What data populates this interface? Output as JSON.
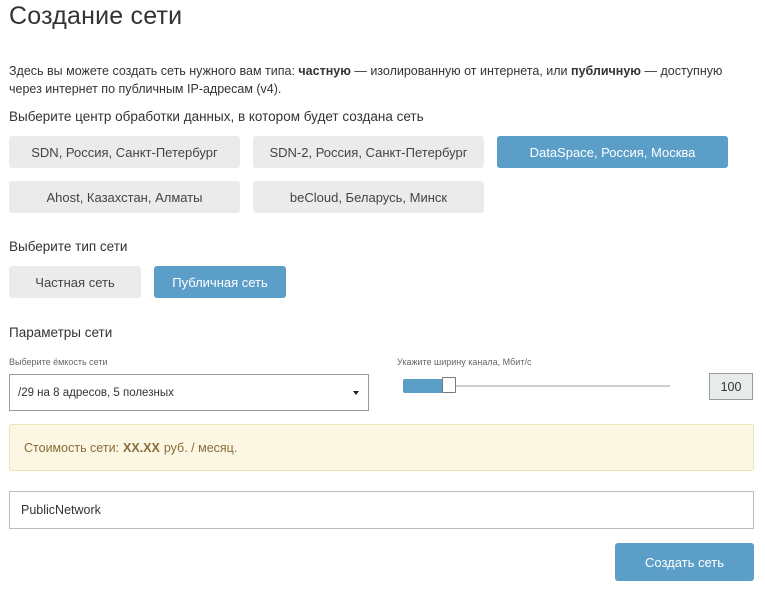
{
  "page": {
    "title": "Создание сети"
  },
  "intro": {
    "text_1": "Здесь вы можете создать сеть нужного вам типа: ",
    "private_word": "частную",
    "text_2": " — изолированную от интернета, или ",
    "public_word": "публичную",
    "text_3": " — доступную через интернет по публичным IP-адресам (v4)."
  },
  "datacenter": {
    "label": "Выберите центр обработки данных, в котором будет создана сеть",
    "options": [
      {
        "label": "SDN, Россия, Санкт-Петербург",
        "selected": false
      },
      {
        "label": "SDN-2, Россия, Санкт-Петербург",
        "selected": false
      },
      {
        "label": "DataSpace, Россия, Москва",
        "selected": true
      },
      {
        "label": "Ahost, Казахстан, Алматы",
        "selected": false
      },
      {
        "label": "beCloud, Беларусь, Минск",
        "selected": false
      }
    ]
  },
  "network_type": {
    "label": "Выберите тип сети",
    "options": [
      {
        "label": "Частная сеть",
        "selected": false
      },
      {
        "label": "Публичная сеть",
        "selected": true
      }
    ]
  },
  "params": {
    "label": "Параметры сети",
    "capacity_label": "Выберите ёмкость сети",
    "capacity_value": "/29 на 8 адресов, 5 полезных",
    "bandwidth_label": "Укажите ширину канала, Мбит/с",
    "bandwidth_value": "100",
    "bandwidth_fraction": 0.15
  },
  "cost": {
    "prefix": "Стоимость сети:",
    "amount": "XX.XX",
    "suffix": "руб. / месяц."
  },
  "name_input": {
    "value": "PublicNetwork"
  },
  "submit": {
    "label": "Создать сеть"
  },
  "colors": {
    "accent": "#5b9fc9",
    "button_bg": "#ebebeb",
    "notice_bg": "#fbf7e2",
    "notice_text": "#8a6d3b"
  }
}
